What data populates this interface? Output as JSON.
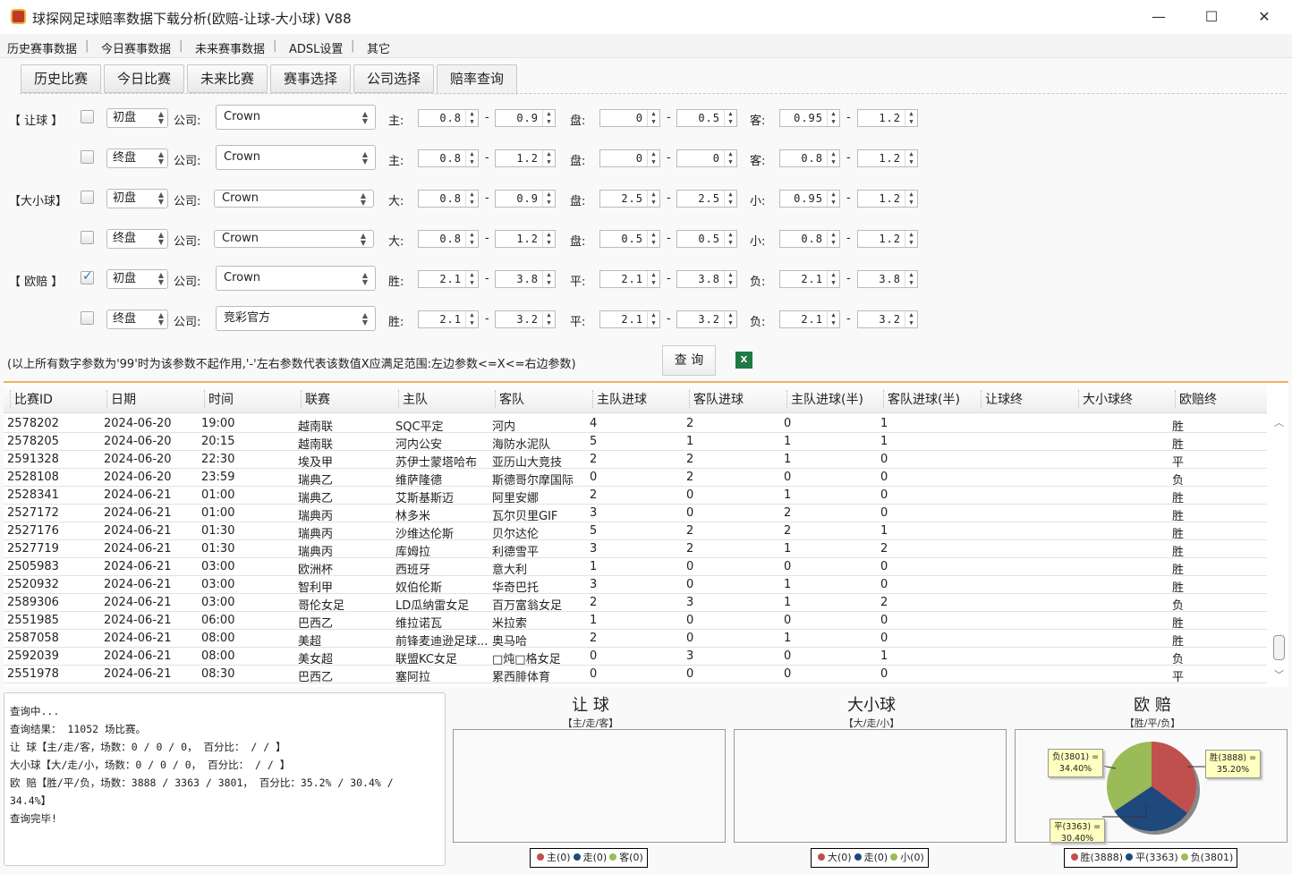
{
  "window": {
    "title": "球探网足球赔率数据下载分析(欧赔-让球-大小球) V88",
    "minimize": "—",
    "maximize": "☐",
    "close": "✕"
  },
  "menu": [
    "历史赛事数据",
    "今日赛事数据",
    "未来赛事数据",
    "ADSL设置",
    "其它"
  ],
  "tabs": [
    "历史比赛",
    "今日比赛",
    "未来比赛",
    "赛事选择",
    "公司选择",
    "赔率查询"
  ],
  "active_tab": "赔率查询",
  "filters": {
    "company_label": "公司:",
    "rows": [
      {
        "group": "【 让球 】",
        "checked": false,
        "stage": "初盘",
        "company": "Crown",
        "labels": [
          "主:",
          "盘:",
          "客:"
        ],
        "values": [
          "0.8",
          "0.9",
          "0",
          "0.5",
          "0.95",
          "1.2"
        ]
      },
      {
        "group": "",
        "checked": false,
        "stage": "终盘",
        "company": "Crown",
        "labels": [
          "主:",
          "盘:",
          "客:"
        ],
        "values": [
          "0.8",
          "1.2",
          "0",
          "0",
          "0.8",
          "1.2"
        ]
      },
      {
        "group": "【大小球】",
        "checked": false,
        "stage": "初盘",
        "company": "Crown",
        "labels": [
          "大:",
          "盘:",
          "小:"
        ],
        "values": [
          "0.8",
          "0.9",
          "2.5",
          "2.5",
          "0.95",
          "1.2"
        ]
      },
      {
        "group": "",
        "checked": false,
        "stage": "终盘",
        "company": "Crown",
        "labels": [
          "大:",
          "盘:",
          "小:"
        ],
        "values": [
          "0.8",
          "1.2",
          "0.5",
          "0.5",
          "0.8",
          "1.2"
        ]
      },
      {
        "group": "【 欧赔 】",
        "checked": true,
        "stage": "初盘",
        "company": "Crown",
        "labels": [
          "胜:",
          "平:",
          "负:"
        ],
        "values": [
          "2.1",
          "3.8",
          "2.1",
          "3.8",
          "2.1",
          "3.8"
        ]
      },
      {
        "group": "",
        "checked": false,
        "stage": "终盘",
        "company": "竞彩官方",
        "labels": [
          "胜:",
          "平:",
          "负:"
        ],
        "values": [
          "2.1",
          "3.2",
          "2.1",
          "3.2",
          "2.1",
          "3.2"
        ]
      }
    ],
    "note": "(以上所有数字参数为'99'时为该参数不起作用,'-'左右参数代表该数值X应满足范围:左边参数<=X<=右边参数)",
    "query_button": "查 询",
    "excel_icon": "excel-export-icon"
  },
  "table": {
    "columns": [
      "比赛ID",
      "日期",
      "时间",
      "联赛",
      "主队",
      "客队",
      "主队进球",
      "客队进球",
      "主队进球(半)",
      "客队进球(半)",
      "让球终",
      "大小球终",
      "欧赔终"
    ],
    "rows": [
      [
        "2578202",
        "2024-06-20",
        "19:00",
        "越南联",
        "SQC平定",
        "河内",
        "4",
        "2",
        "0",
        "1",
        "",
        "",
        "胜"
      ],
      [
        "2578205",
        "2024-06-20",
        "20:15",
        "越南联",
        "河内公安",
        "海防水泥队",
        "5",
        "1",
        "1",
        "1",
        "",
        "",
        "胜"
      ],
      [
        "2591328",
        "2024-06-20",
        "22:30",
        "埃及甲",
        "苏伊士蒙塔哈布",
        "亚历山大竞技",
        "2",
        "2",
        "1",
        "0",
        "",
        "",
        "平"
      ],
      [
        "2528108",
        "2024-06-20",
        "23:59",
        "瑞典乙",
        "维萨隆德",
        "斯德哥尔摩国际",
        "0",
        "2",
        "0",
        "0",
        "",
        "",
        "负"
      ],
      [
        "2528341",
        "2024-06-21",
        "01:00",
        "瑞典乙",
        "艾斯基斯迈",
        "阿里安娜",
        "2",
        "0",
        "1",
        "0",
        "",
        "",
        "胜"
      ],
      [
        "2527172",
        "2024-06-21",
        "01:00",
        "瑞典丙",
        "林多米",
        "瓦尔贝里GIF",
        "3",
        "0",
        "2",
        "0",
        "",
        "",
        "胜"
      ],
      [
        "2527176",
        "2024-06-21",
        "01:30",
        "瑞典丙",
        "沙维达伦斯",
        "贝尔达伦",
        "5",
        "2",
        "2",
        "1",
        "",
        "",
        "胜"
      ],
      [
        "2527719",
        "2024-06-21",
        "01:30",
        "瑞典丙",
        "库姆拉",
        "利德雪平",
        "3",
        "2",
        "1",
        "2",
        "",
        "",
        "胜"
      ],
      [
        "2505983",
        "2024-06-21",
        "03:00",
        "欧洲杯",
        "西班牙",
        "意大利",
        "1",
        "0",
        "0",
        "0",
        "",
        "",
        "胜"
      ],
      [
        "2520932",
        "2024-06-21",
        "03:00",
        "智利甲",
        "奴伯伦斯",
        "华奇巴托",
        "3",
        "0",
        "1",
        "0",
        "",
        "",
        "胜"
      ],
      [
        "2589306",
        "2024-06-21",
        "03:00",
        "哥伦女足",
        "LD瓜纳雷女足",
        "百万富翁女足",
        "2",
        "3",
        "1",
        "2",
        "",
        "",
        "负"
      ],
      [
        "2551985",
        "2024-06-21",
        "06:00",
        "巴西乙",
        "维拉诺瓦",
        "米拉索",
        "1",
        "0",
        "0",
        "0",
        "",
        "",
        "胜"
      ],
      [
        "2587058",
        "2024-06-21",
        "08:00",
        "美超",
        "前锋麦迪逊足球...",
        "奥马哈",
        "2",
        "0",
        "1",
        "0",
        "",
        "",
        "胜"
      ],
      [
        "2592039",
        "2024-06-21",
        "08:00",
        "美女超",
        "联盟KC女足",
        "□炖□格女足",
        "0",
        "3",
        "0",
        "1",
        "",
        "",
        "负"
      ],
      [
        "2551978",
        "2024-06-21",
        "08:30",
        "巴西乙",
        "塞阿拉",
        "累西腓体育",
        "0",
        "0",
        "0",
        "0",
        "",
        "",
        "平"
      ]
    ]
  },
  "log": {
    "lines": [
      "查询中...",
      "查询结果： 11052 场比赛。",
      "让  球【主/走/客，场数：0 / 0 / 0， 百分比： /  / 】",
      "大小球【大/走/小，场数：0 / 0 / 0， 百分比： /  / 】",
      "欧  赔【胜/平/负，场数：3888 / 3363 / 3801， 百分比：35.2% / 30.4% /",
      "34.4%】",
      "查询完毕!"
    ]
  },
  "colors": {
    "red": "#c0504d",
    "blue": "#1f497d",
    "green": "#9bbb59"
  },
  "chart_data": [
    {
      "type": "pie",
      "title": "让  球",
      "subtitle": "【主/走/客】",
      "slices": [
        {
          "label": "主",
          "value": 0
        },
        {
          "label": "走",
          "value": 0
        },
        {
          "label": "客",
          "value": 0
        }
      ],
      "legend": [
        "主(0)",
        "走(0)",
        "客(0)"
      ],
      "legend_position": "bottom"
    },
    {
      "type": "pie",
      "title": "大小球",
      "subtitle": "【大/走/小】",
      "slices": [
        {
          "label": "大",
          "value": 0
        },
        {
          "label": "走",
          "value": 0
        },
        {
          "label": "小",
          "value": 0
        }
      ],
      "legend": [
        "大(0)",
        "走(0)",
        "小(0)"
      ],
      "legend_position": "bottom"
    },
    {
      "type": "pie",
      "title": "欧  赔",
      "subtitle": "【胜/平/负】",
      "slices": [
        {
          "label": "胜",
          "value": 3888,
          "percent": 35.2
        },
        {
          "label": "平",
          "value": 3363,
          "percent": 30.4
        },
        {
          "label": "负",
          "value": 3801,
          "percent": 34.4
        }
      ],
      "data_labels": [
        [
          "胜(3888) =",
          "35.20%"
        ],
        [
          "平(3363) =",
          "30.40%"
        ],
        [
          "负(3801) =",
          "34.40%"
        ]
      ],
      "legend": [
        "胜(3888)",
        "平(3363)",
        "负(3801)"
      ],
      "legend_position": "bottom"
    }
  ]
}
